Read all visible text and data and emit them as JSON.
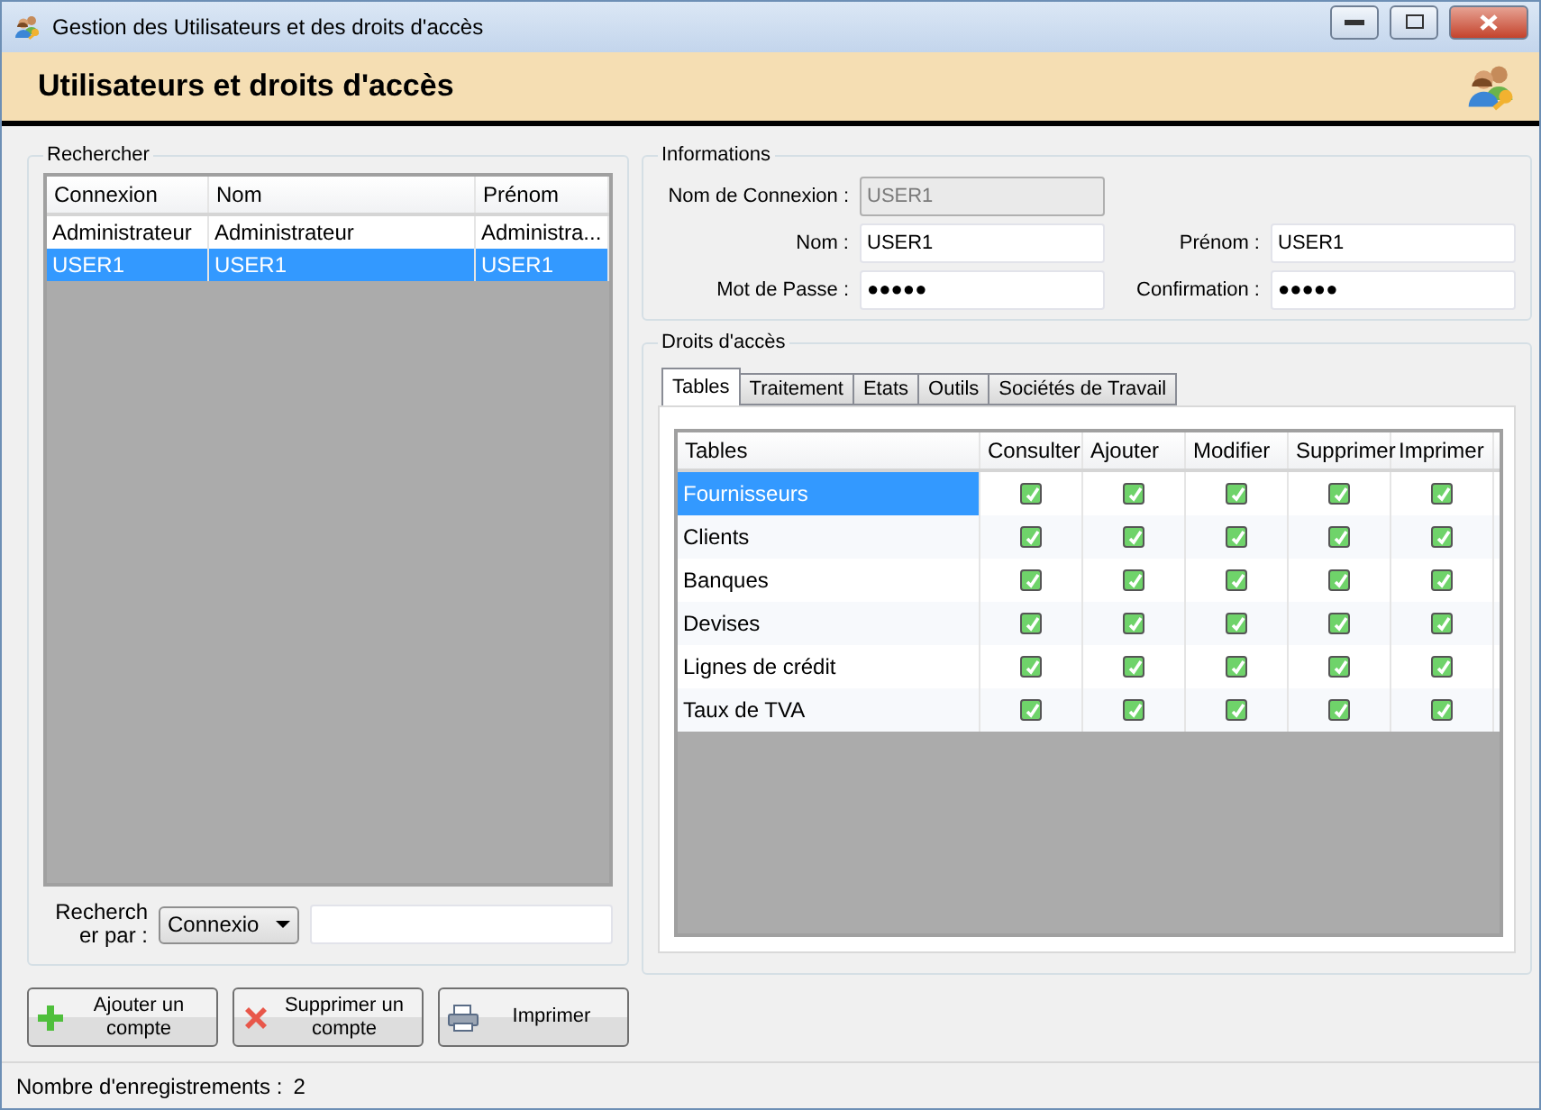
{
  "window": {
    "title": "Gestion des Utilisateurs et des droits d'accès"
  },
  "banner": {
    "title": "Utilisateurs et droits d'accès"
  },
  "search_group": {
    "title": "Rechercher",
    "columns": [
      "Connexion",
      "Nom",
      "Prénom"
    ],
    "rows": [
      {
        "cells": [
          "Administrateur",
          "Administrateur",
          "Administra..."
        ],
        "selected": false
      },
      {
        "cells": [
          "USER1",
          "USER1",
          "USER1"
        ],
        "selected": true
      }
    ],
    "search_label": "Rechercher par :",
    "search_by": "Connexio"
  },
  "info_group": {
    "title": "Informations",
    "login_label": "Nom de Connexion :",
    "login": "USER1",
    "nom_label": "Nom :",
    "nom": "USER1",
    "prenom_label": "Prénom :",
    "prenom": "USER1",
    "password_label": "Mot de Passe :",
    "password": "●●●●●",
    "confirm_label": "Confirmation :",
    "confirm": "●●●●●"
  },
  "rights_group": {
    "title": "Droits d'accès",
    "tabs": [
      {
        "label": "Tables",
        "selected": true
      },
      {
        "label": "Traitement",
        "selected": false
      },
      {
        "label": "Etats",
        "selected": false
      },
      {
        "label": "Outils",
        "selected": false
      },
      {
        "label": "Sociétés de Travail",
        "selected": false
      }
    ],
    "columns": [
      "Tables",
      "Consulter",
      "Ajouter",
      "Modifier",
      "Supprimer",
      "Imprimer"
    ],
    "rows": [
      {
        "name": "Fournisseurs",
        "selected": true,
        "rights": [
          true,
          true,
          true,
          true,
          true
        ]
      },
      {
        "name": "Clients",
        "selected": false,
        "rights": [
          true,
          true,
          true,
          true,
          true
        ]
      },
      {
        "name": "Banques",
        "selected": false,
        "rights": [
          true,
          true,
          true,
          true,
          true
        ]
      },
      {
        "name": "Devises",
        "selected": false,
        "rights": [
          true,
          true,
          true,
          true,
          true
        ]
      },
      {
        "name": "Lignes de crédit",
        "selected": false,
        "rights": [
          true,
          true,
          true,
          true,
          true
        ]
      },
      {
        "name": "Taux de TVA",
        "selected": false,
        "rights": [
          true,
          true,
          true,
          true,
          true
        ]
      }
    ]
  },
  "buttons": [
    {
      "kind": "add",
      "label": "Ajouter un compte"
    },
    {
      "kind": "delete",
      "label": "Supprimer un compte"
    },
    {
      "kind": "print",
      "label": "Imprimer"
    }
  ],
  "status_bar": {
    "label": "Nombre d'enregistrements :",
    "count": "2"
  }
}
